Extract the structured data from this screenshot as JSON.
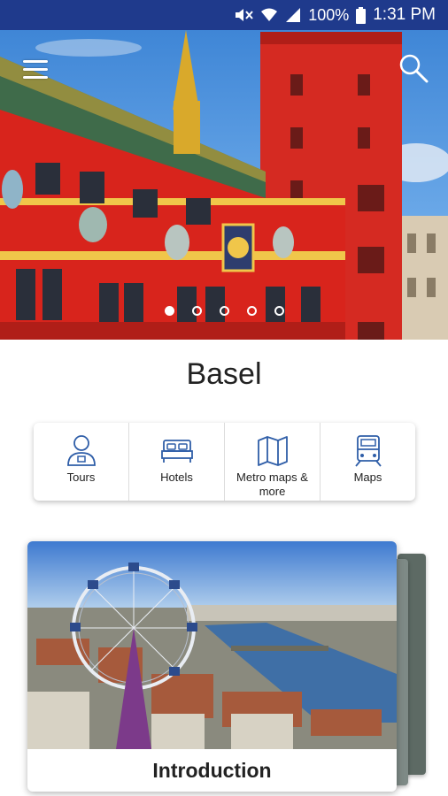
{
  "status_bar": {
    "battery_percent": "100%",
    "time": "1:31 PM",
    "icons": [
      "mute-icon",
      "wifi-icon",
      "signal-icon",
      "battery-icon"
    ]
  },
  "hero": {
    "slides_total": 5,
    "active_slide": 1,
    "icons": {
      "menu": "hamburger-menu-icon",
      "search": "search-icon"
    }
  },
  "city": {
    "name": "Basel"
  },
  "quick_links": [
    {
      "label": "Tours",
      "icon": "tour-guide-icon"
    },
    {
      "label": "Hotels",
      "icon": "bed-icon"
    },
    {
      "label": "Metro maps & more",
      "icon": "folded-map-icon"
    },
    {
      "label": "Maps",
      "icon": "train-icon"
    }
  ],
  "cards": [
    {
      "title": "Introduction"
    }
  ],
  "colors": {
    "status_bar": "#1f3a8c",
    "accent_icon": "#2f5ea8",
    "town_hall_red": "#d8241c"
  }
}
